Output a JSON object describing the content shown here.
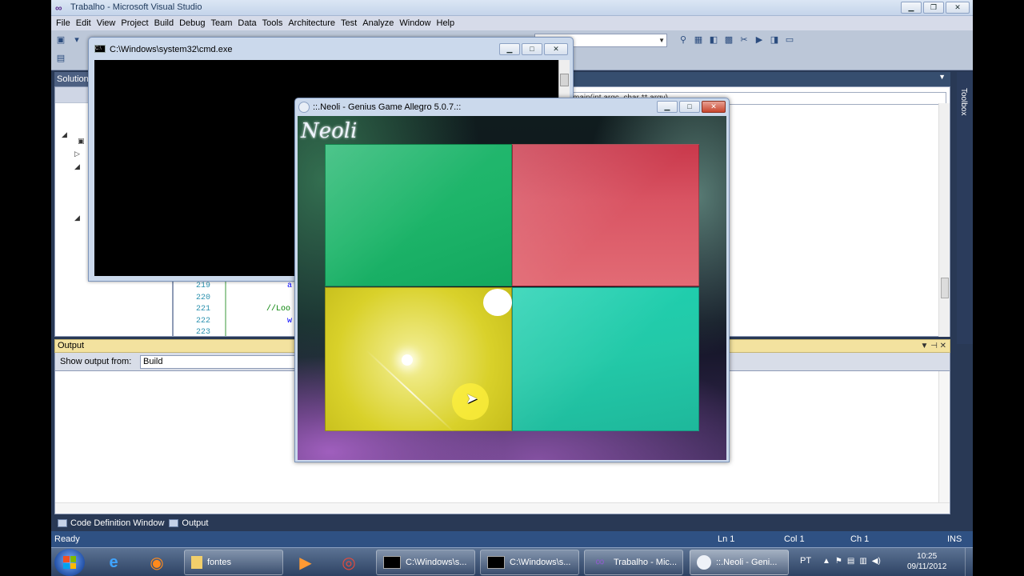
{
  "vs": {
    "title": "Trabalho - Microsoft Visual Studio",
    "menu": [
      "File",
      "Edit",
      "View",
      "Project",
      "Build",
      "Debug",
      "Team",
      "Data",
      "Tools",
      "Architecture",
      "Test",
      "Analyze",
      "Window",
      "Help"
    ],
    "solution_explorer_title": "Solution",
    "editor_nav_combo": "main(int argc, char ** argv)",
    "line_numbers": [
      "219",
      "220",
      "221",
      "222",
      "223"
    ],
    "code_lines": [
      "a",
      "",
      "//Loo",
      "w",
      ""
    ],
    "toolbox_label": "Toolbox",
    "output_title": "Output",
    "show_output_from_label": "Show output from:",
    "show_output_from_value": "Build",
    "bottom_tabs": [
      "Code Definition Window",
      "Output"
    ],
    "status": {
      "ready": "Ready",
      "ln": "Ln 1",
      "col": "Col 1",
      "ch": "Ch 1",
      "ins": "INS"
    }
  },
  "cmd": {
    "title": "C:\\Windows\\system32\\cmd.exe"
  },
  "game": {
    "title": "::.Neoli - Genius Game Allegro 5.0.7.::",
    "logo": "Neoli",
    "quadrants": [
      "green",
      "red",
      "yellow",
      "teal"
    ],
    "colors": {
      "green": "#1eb56a",
      "red": "#d95463",
      "yellow": "#d9d12a",
      "teal": "#23c9a8"
    }
  },
  "taskbar": {
    "tasks": [
      {
        "label": "fontes"
      },
      {
        "label": "C:\\Windows\\s..."
      },
      {
        "label": "C:\\Windows\\s..."
      },
      {
        "label": "Trabalho - Mic..."
      },
      {
        "label": "::.Neoli - Geni..."
      }
    ],
    "lang": "PT",
    "time": "10:25",
    "date": "09/11/2012"
  }
}
